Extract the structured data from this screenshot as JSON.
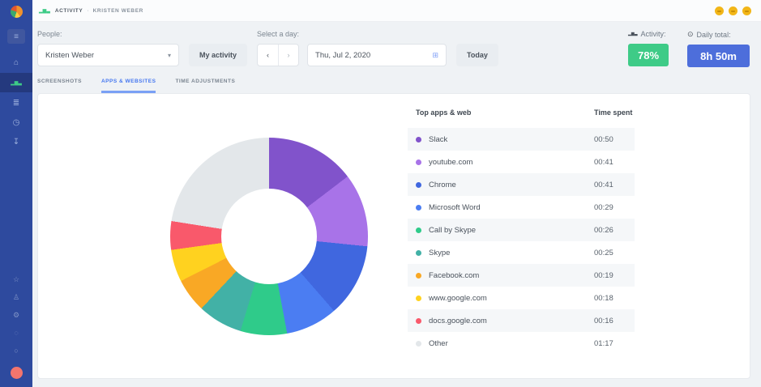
{
  "topbar": {
    "breadcrumb": {
      "section": "ACTIVITY",
      "separator": "·",
      "user": "KRISTEN WEBER"
    },
    "emoji_badge_count": 3
  },
  "sidebar": {
    "menu_glyph": "≡",
    "items_top": [
      {
        "name": "home-icon",
        "glyph": "⌂",
        "active": false
      },
      {
        "name": "activity-icon",
        "glyph": "▂▆▃",
        "active": true,
        "bars": true
      },
      {
        "name": "timesheets-icon",
        "glyph": "≣",
        "active": false
      },
      {
        "name": "time-icon",
        "glyph": "◷",
        "active": false
      },
      {
        "name": "reports-icon",
        "glyph": "↧",
        "active": false
      }
    ],
    "items_bottom": [
      {
        "name": "achievements-icon",
        "glyph": "☆"
      },
      {
        "name": "people-icon",
        "glyph": "♙"
      },
      {
        "name": "settings-icon",
        "glyph": "⚙"
      },
      {
        "name": "help-icon",
        "glyph": "◌"
      },
      {
        "name": "status-icon",
        "glyph": "○"
      }
    ],
    "avatar_color": "#f3756d"
  },
  "controls": {
    "people_label": "People:",
    "person_selected": "Kristen Weber",
    "my_activity_label": "My activity",
    "day_label": "Select a day:",
    "prev_glyph": "‹",
    "next_glyph": "›",
    "date_value": "Thu, Jul 2, 2020",
    "calendar_glyph": "⊞",
    "today_label": "Today",
    "activity_label": "Activity:",
    "activity_value": "78%",
    "activity_color": "#3ecb87",
    "daily_total_label": "Daily total:",
    "daily_total_value": "8h 50m",
    "daily_total_color": "#4d6edb"
  },
  "tabs": [
    {
      "label": "SCREENSHOTS",
      "active": false
    },
    {
      "label": "APPS & WEBSITES",
      "active": true
    },
    {
      "label": "TIME ADJUSTMENTS",
      "active": false
    }
  ],
  "table": {
    "headers": [
      "Top apps & web",
      "Time spent"
    ],
    "rows": [
      {
        "name": "Slack",
        "time": "00:50",
        "color": "#8153cb"
      },
      {
        "name": "youtube.com",
        "time": "00:41",
        "color": "#a873e8"
      },
      {
        "name": "Chrome",
        "time": "00:41",
        "color": "#4067df"
      },
      {
        "name": "Microsoft Word",
        "time": "00:29",
        "color": "#4b7df2"
      },
      {
        "name": "Call by Skype",
        "time": "00:26",
        "color": "#2fcb8a"
      },
      {
        "name": "Skype",
        "time": "00:25",
        "color": "#42b1a6"
      },
      {
        "name": "Facebook.com",
        "time": "00:19",
        "color": "#f9a825"
      },
      {
        "name": "www.google.com",
        "time": "00:18",
        "color": "#ffd21f"
      },
      {
        "name": "docs.google.com",
        "time": "00:16",
        "color": "#f9596b"
      },
      {
        "name": "Other",
        "time": "01:17",
        "color": "#e3e7ea"
      }
    ]
  },
  "chart_data": {
    "type": "pie",
    "subtype": "donut",
    "title": "Top apps & web",
    "labels": [
      "Slack",
      "youtube.com",
      "Chrome",
      "Microsoft Word",
      "Call by Skype",
      "Skype",
      "Facebook.com",
      "www.google.com",
      "docs.google.com",
      "Other"
    ],
    "values_minutes": [
      50,
      41,
      41,
      29,
      26,
      25,
      19,
      18,
      16,
      77
    ],
    "time_labels": [
      "00:50",
      "00:41",
      "00:41",
      "00:29",
      "00:26",
      "00:25",
      "00:19",
      "00:18",
      "00:16",
      "01:17"
    ],
    "colors": [
      "#8153cb",
      "#a873e8",
      "#4067df",
      "#4b7df2",
      "#2fcb8a",
      "#42b1a6",
      "#f9a825",
      "#ffd21f",
      "#f9596b",
      "#e3e7ea"
    ],
    "total_minutes": 342,
    "start_angle_deg": 0,
    "direction": "clockwise",
    "legend_position": "right-table"
  }
}
